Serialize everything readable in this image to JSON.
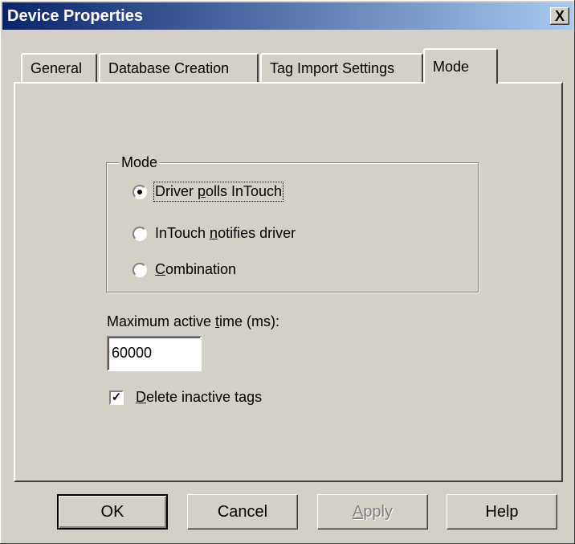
{
  "window": {
    "title": "Device Properties",
    "close_label": "X"
  },
  "tabs": [
    {
      "label": "General"
    },
    {
      "label": "Database Creation"
    },
    {
      "label": "Tag Import Settings"
    },
    {
      "label": "Mode",
      "selected": true
    }
  ],
  "mode_group": {
    "label": "Mode",
    "options": [
      {
        "pre": "Driver ",
        "key": "p",
        "post": "olls InTouch",
        "selected": true
      },
      {
        "pre": "InTouch ",
        "key": "n",
        "post": "otifies driver",
        "selected": false
      },
      {
        "pre": "",
        "key": "C",
        "post": "ombination",
        "selected": false
      }
    ]
  },
  "max_active": {
    "pre": "Maximum active ",
    "key": "t",
    "post": "ime (ms):",
    "value": "60000"
  },
  "delete_inactive": {
    "pre": "",
    "key": "D",
    "post": "elete inactive tags",
    "checked": true
  },
  "buttons": [
    {
      "label": "OK",
      "default": true,
      "enabled": true
    },
    {
      "label": "Cancel",
      "enabled": true
    },
    {
      "label": "Apply",
      "key": "A",
      "post": "pply",
      "enabled": false
    },
    {
      "label": "Help",
      "enabled": true
    }
  ]
}
